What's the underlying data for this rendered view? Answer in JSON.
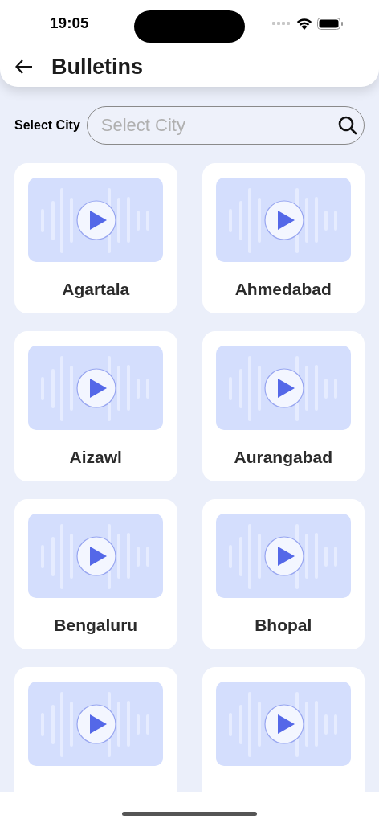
{
  "status_bar": {
    "time": "19:05"
  },
  "header": {
    "title": "Bulletins"
  },
  "search": {
    "label": "Select City",
    "placeholder": "Select City"
  },
  "cities": [
    {
      "kind": "full",
      "name": "Agartala"
    },
    {
      "kind": "full",
      "name": "Ahmedabad"
    },
    {
      "kind": "full",
      "name": "Aizawl"
    },
    {
      "kind": "full",
      "name": "Aurangabad"
    },
    {
      "kind": "full",
      "name": "Bengaluru"
    },
    {
      "kind": "full",
      "name": "Bhopal"
    },
    {
      "kind": "cut"
    },
    {
      "kind": "cut"
    }
  ]
}
